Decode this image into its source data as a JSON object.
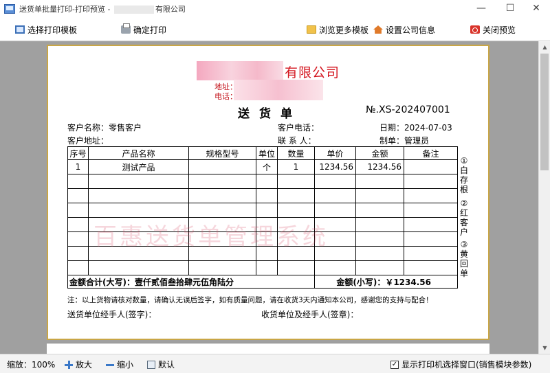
{
  "window": {
    "title_prefix": "送货单批量打印-打印预览 - ",
    "title_suffix": "有限公司",
    "minimize": "—",
    "maximize": "☐",
    "close": "✕"
  },
  "toolbar": {
    "select_template": "选择打印模板",
    "confirm_print": "确定打印",
    "browse_templates": "浏览更多模板",
    "company_info": "设置公司信息",
    "close_preview": "关闭预览"
  },
  "document": {
    "company_suffix": "有限公司",
    "address_label": "地址：",
    "phone_label": "电话：",
    "title": "送货单",
    "number": "№.XS-202407001",
    "customer_name_label": "客户名称：",
    "customer_name": "零售客户",
    "customer_phone_label": "客户电话：",
    "date_label": "日期：",
    "date": "2024-07-03",
    "customer_address_label": "客户地址：",
    "contact_label": "联 系 人：",
    "maker_label": "制单：",
    "maker": "管理员",
    "columns": [
      "序号",
      "产品名称",
      "规格型号",
      "单位",
      "数量",
      "单价",
      "金额",
      "备注"
    ],
    "rows": [
      [
        "1",
        "测试产品",
        "",
        "个",
        "1",
        "1234.56",
        "1234.56",
        ""
      ]
    ],
    "total_upper_label": "金额合计(大写)：",
    "total_upper": "壹仟贰佰叁拾肆元伍角陆分",
    "total_lower_label": "金额(小写)：",
    "total_lower": "￥1234.56",
    "stub_white": "①白存根",
    "stub_red": "②红客户",
    "stub_yellow": "③黄回单",
    "watermark": "百惠送货单管理系统",
    "note": "注：以上货物请核对数量，请确认无误后签字，如有质量问题，请在收货3天内通知本公司，感谢您的支持与配合！",
    "sender_sign": "送货单位经手人(签字)：",
    "receiver_sign": "收货单位及经手人(签章)："
  },
  "statusbar": {
    "zoom_label": "缩放：",
    "zoom_value": "100%",
    "zoom_in": "放大",
    "zoom_out": "缩小",
    "default": "默认",
    "show_printer_checkbox": "显示打印机选择窗口(销售模块参数)",
    "show_printer_checked": true
  }
}
